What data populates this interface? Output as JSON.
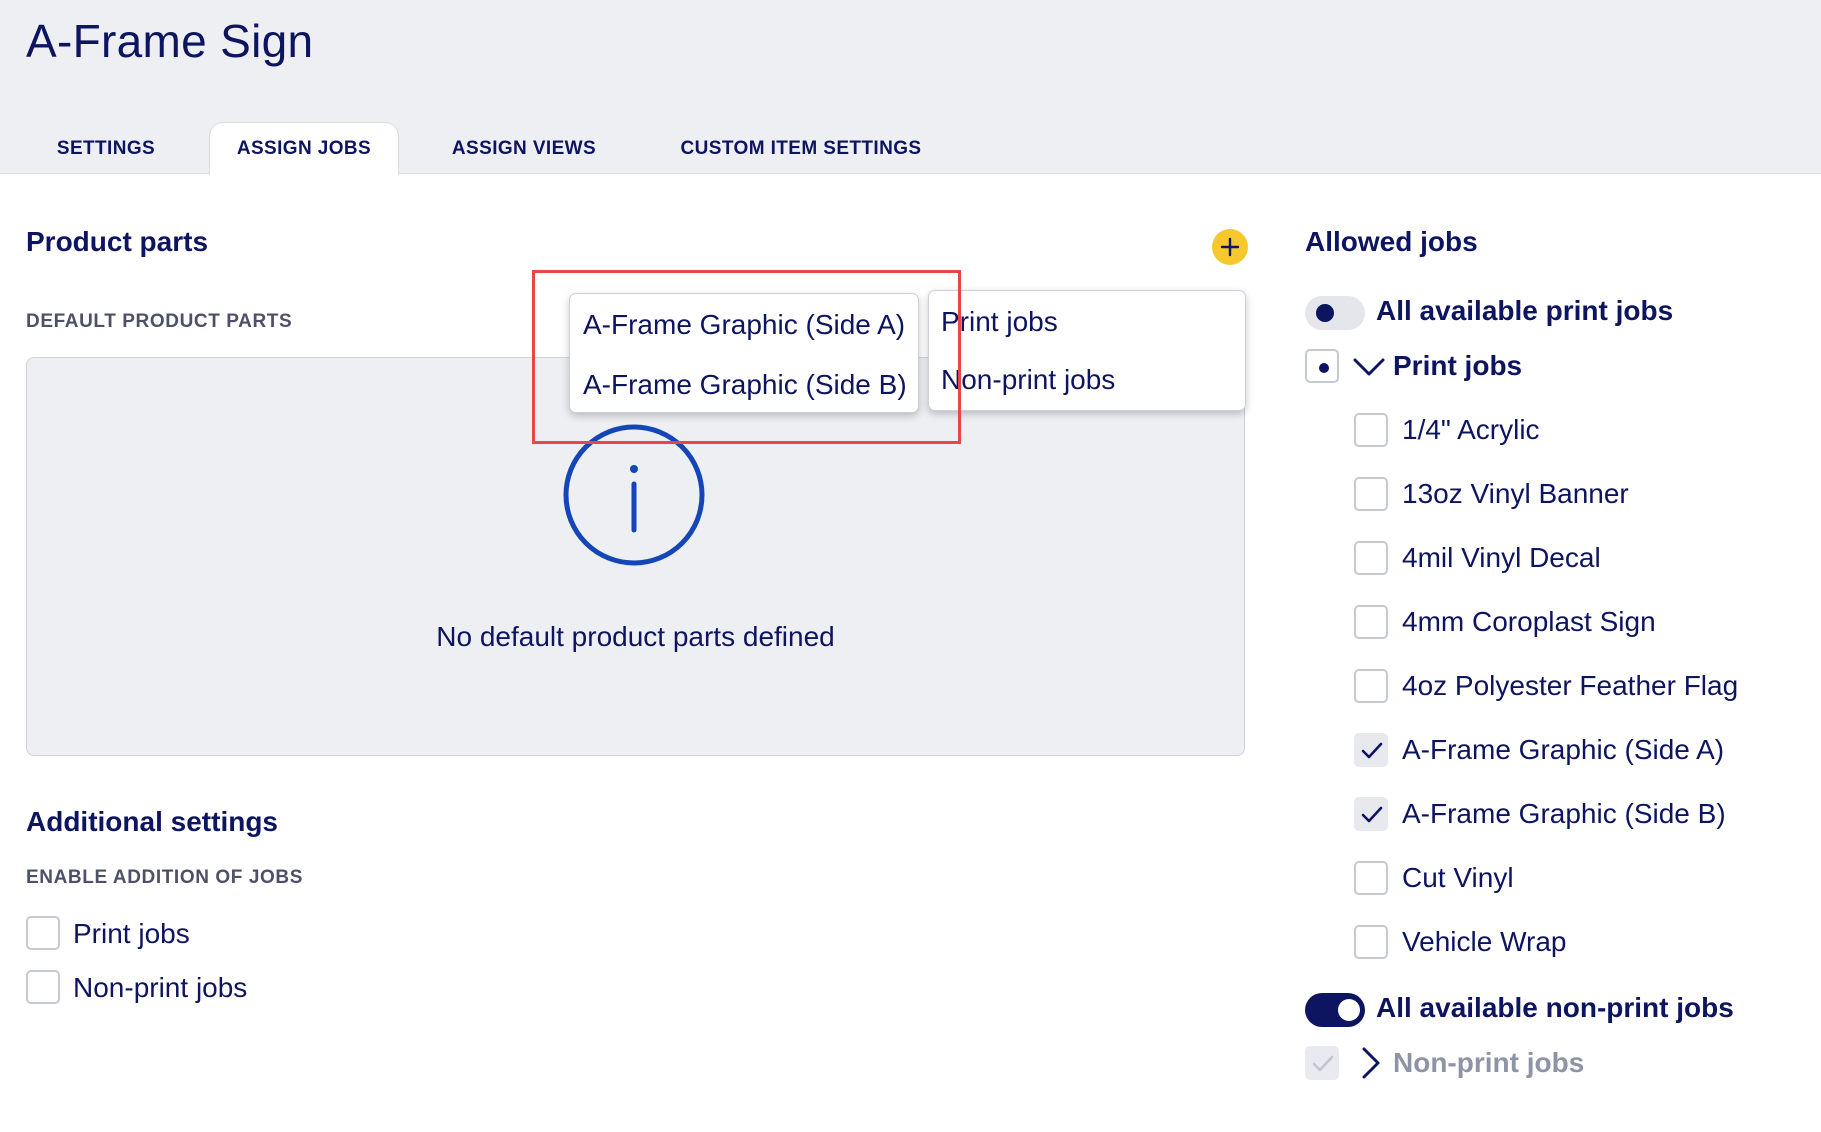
{
  "header": {
    "title": "A-Frame Sign",
    "tabs": [
      {
        "label": "SETTINGS",
        "active": false
      },
      {
        "label": "ASSIGN JOBS",
        "active": true
      },
      {
        "label": "ASSIGN VIEWS",
        "active": false
      },
      {
        "label": "CUSTOM ITEM SETTINGS",
        "active": false
      }
    ]
  },
  "product_parts": {
    "title": "Product parts",
    "add_icon": "plus-icon",
    "default_label": "DEFAULT PRODUCT PARTS",
    "empty_icon": "info-icon",
    "empty_text": "No default product parts defined"
  },
  "parts_popup": {
    "items": [
      "A-Frame Graphic (Side A)",
      "A-Frame Graphic (Side B)"
    ]
  },
  "job_type_popup": {
    "items": [
      "Print jobs",
      "Non-print jobs"
    ]
  },
  "additional_settings": {
    "title": "Additional settings",
    "subtitle": "ENABLE ADDITION OF JOBS",
    "options": [
      {
        "label": "Print jobs",
        "checked": false
      },
      {
        "label": "Non-print jobs",
        "checked": false
      }
    ]
  },
  "allowed_jobs": {
    "title": "Allowed jobs",
    "all_print": {
      "label": "All available print jobs",
      "on": false
    },
    "print_group": {
      "label": "Print jobs",
      "state": "partial",
      "expanded": true,
      "items": [
        {
          "label": "1/4\" Acrylic",
          "checked": false
        },
        {
          "label": "13oz Vinyl Banner",
          "checked": false
        },
        {
          "label": "4mil Vinyl Decal",
          "checked": false
        },
        {
          "label": "4mm Coroplast Sign",
          "checked": false
        },
        {
          "label": "4oz Polyester Feather Flag",
          "checked": false
        },
        {
          "label": "A-Frame Graphic (Side A)",
          "checked": true
        },
        {
          "label": "A-Frame Graphic (Side B)",
          "checked": true
        },
        {
          "label": "Cut Vinyl",
          "checked": false
        },
        {
          "label": "Vehicle Wrap",
          "checked": false
        }
      ]
    },
    "all_nonprint": {
      "label": "All available non-print jobs",
      "on": true
    },
    "nonprint_group": {
      "label": "Non-print jobs",
      "checked": true,
      "disabled": true,
      "expanded": false
    }
  },
  "colors": {
    "navy": "#0d1460",
    "accent_yellow": "#f7c82e",
    "info_blue": "#1446b8",
    "highlight_red": "#e8474a",
    "header_bg": "#eeeff3"
  }
}
